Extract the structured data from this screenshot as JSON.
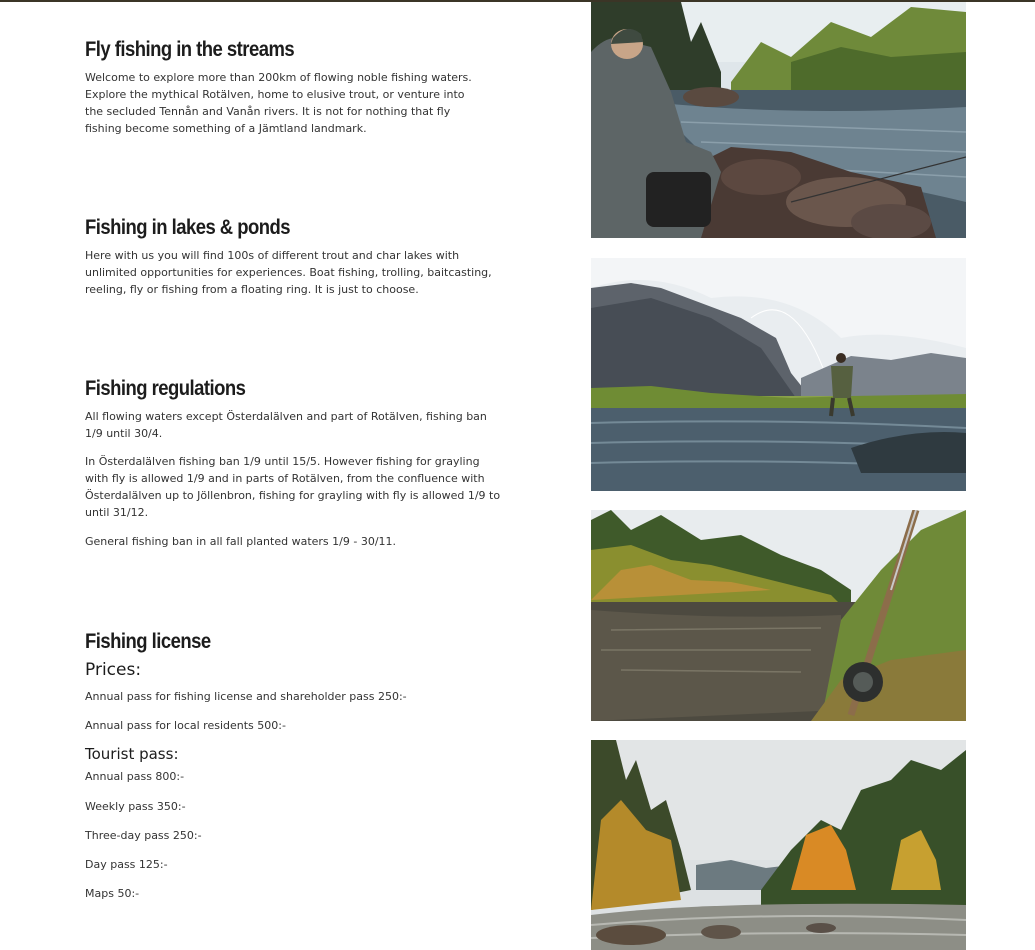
{
  "sections": {
    "streams": {
      "title": "Fly fishing in the streams",
      "text": "Welcome to explore more than 200km of flowing noble fishing waters. Explore the mythical Rotälven, home to elusive trout, or venture into the secluded Tennån and Vanån rivers. It is not for nothing that fly fishing become something of a Jämtland landmark."
    },
    "lakes": {
      "title": "Fishing in lakes & ponds",
      "text": "Here with us you will find 100s of different trout and char lakes with unlimited opportunities for experiences. Boat fishing, trolling, baitcasting, reeling, fly or fishing from a floating ring. It is just to choose."
    },
    "regulations": {
      "title": "Fishing regulations",
      "p1": "All flowing waters except Österdalälven and part of Rotälven, fishing ban 1/9 until 30/4.",
      "p2": "In Österdalälven fishing ban 1/9 until 15/5. However fishing for grayling with fly is allowed 1/9 and in parts of Rotälven, from the confluence with Österdalälven up to Jöllenbron, fishing for grayling with fly is allowed 1/9 to until 31/12.",
      "p3": "General fishing ban in all fall planted waters 1/9 - 30/11."
    },
    "license": {
      "title": "Fishing license",
      "prices_heading": "Prices:",
      "annual_shareholder": "Annual pass for fishing license and shareholder pass 250:-",
      "annual_local": "Annual pass for local residents 500:-",
      "tourist_heading": "Tourist pass:",
      "tourist": [
        "Annual pass 800:-",
        "Weekly pass 350:-",
        "Three-day pass 250:-",
        "Day pass 125:-",
        "Maps 50:-"
      ]
    }
  },
  "colors": {
    "topbar": "#3b3526",
    "heading": "#1c1c1c",
    "body_text": "#333333"
  }
}
